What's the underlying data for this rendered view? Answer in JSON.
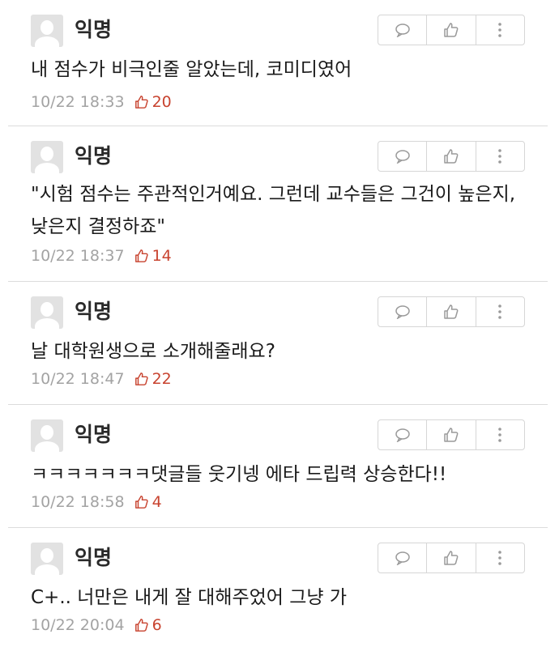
{
  "comments": [
    {
      "author": "익명",
      "text": "내 점수가 비극인줄 알았는데, 코미디였어",
      "time": "10/22 18:33",
      "likes": "20"
    },
    {
      "author": "익명",
      "text": "\"시험 점수는 주관적인거예요. 그런데 교수들은 그건이 높은지, 낮은지 결정하죠\"",
      "time": "10/22 18:37",
      "likes": "14"
    },
    {
      "author": "익명",
      "text": "날 대학원생으로 소개해줄래요?",
      "time": "10/22 18:47",
      "likes": "22"
    },
    {
      "author": "익명",
      "text": "ㅋㅋㅋㅋㅋㅋㅋ댓글들 웃기넹 에타 드립력 상승한다!!",
      "time": "10/22 18:58",
      "likes": "4"
    },
    {
      "author": "익명",
      "text": "C+.. 너만은 내게 잘 대해주었어 그냥 가",
      "time": "10/22 20:04",
      "likes": "6"
    }
  ],
  "icons": {
    "reply": "speech-bubble-icon",
    "like": "thumbs-up-icon",
    "more": "more-vertical-icon",
    "avatar": "user-avatar-icon"
  },
  "colors": {
    "like_accent": "#c8432f",
    "meta_gray": "#a3a3a3",
    "divider": "#dcdcdc"
  }
}
